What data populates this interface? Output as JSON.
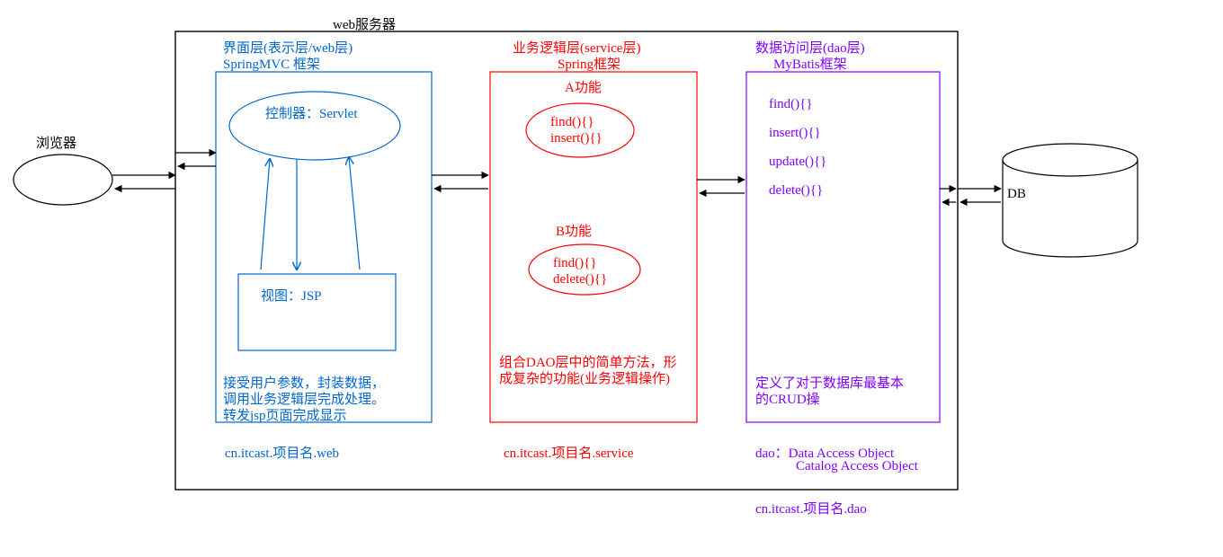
{
  "browser": {
    "label": "浏览器"
  },
  "db": {
    "label": "DB"
  },
  "server": {
    "title": "web服务器"
  },
  "ui_layer": {
    "title": "界面层(表示层/web层)",
    "framework": "SpringMVC 框架",
    "controller": "控制器：Servlet",
    "view": "视图：JSP",
    "desc1": "接受用户参数，封装数据，",
    "desc2": "调用业务逻辑层完成处理。",
    "desc3": "转发jsp页面完成显示",
    "package": "cn.itcast.项目名.web"
  },
  "service_layer": {
    "title": "业务逻辑层(service层)",
    "framework": "Spring框架",
    "a_label": "A功能",
    "a_m1": "find(){}",
    "a_m2": "insert(){}",
    "b_label": "B功能",
    "b_m1": "find(){}",
    "b_m2": "delete(){}",
    "desc1": "组合DAO层中的简单方法，形",
    "desc2": "成复杂的功能(业务逻辑操作)",
    "package": "cn.itcast.项目名.service"
  },
  "dao_layer": {
    "title": "数据访问层(dao层)",
    "framework": "MyBatis框架",
    "m1": "find(){}",
    "m2": "insert(){}",
    "m3": "update(){}",
    "m4": "delete(){}",
    "desc1": "定义了对于数据库最基本",
    "desc2": "的CRUD操",
    "note1": "dao：Data Access Object",
    "note2": "Catalog Access Object",
    "package": "cn.itcast.项目名.dao"
  }
}
